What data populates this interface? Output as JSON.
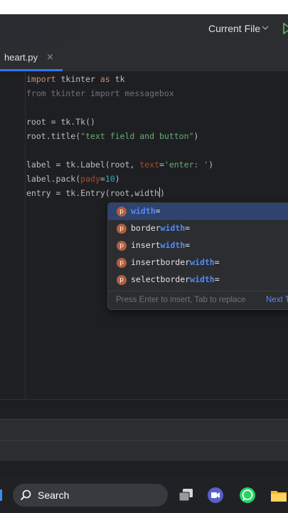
{
  "toolbar": {
    "current_file_label": "Current File",
    "icons": [
      "chevron-down-icon",
      "run-icon"
    ]
  },
  "tabs": [
    {
      "label": "heart.py",
      "close": "×",
      "active": true
    }
  ],
  "editor": {
    "lines": {
      "l1": {
        "a": "import",
        "b": " tkinter ",
        "c": "as",
        "d": " tk"
      },
      "l2": {
        "text": "from tkinter import messagebox"
      },
      "l4": {
        "text": "root = tk.Tk()"
      },
      "l5": {
        "a": "root.title(",
        "b": "\"text field and button\"",
        "c": ")"
      },
      "l7": {
        "a": "label = tk.Label(root, ",
        "b": "text",
        "c": "=",
        "d": "'enter: '",
        "e": ")"
      },
      "l8": {
        "a": "label.pack(",
        "b": "pady",
        "c": "=",
        "d": "10",
        "e": ")"
      },
      "l9": {
        "a": "entry = tk.Entry(root,width",
        "b": ")"
      }
    }
  },
  "completion": {
    "items": [
      {
        "icon": "p",
        "pre": "",
        "match": "width",
        "post": "="
      },
      {
        "icon": "p",
        "pre": "border",
        "match": "width",
        "post": "="
      },
      {
        "icon": "p",
        "pre": "insert",
        "match": "width",
        "post": "="
      },
      {
        "icon": "p",
        "pre": "insertborder",
        "match": "width",
        "post": "="
      },
      {
        "icon": "p",
        "pre": "selectborder",
        "match": "width",
        "post": "="
      }
    ],
    "hint": "Press Enter to insert, Tab to replace",
    "next": "Next Tip"
  },
  "taskbar": {
    "search_label": "Search",
    "icons": [
      "search-icon",
      "task-view-icon",
      "teams-icon",
      "whatsapp-icon",
      "file-explorer-icon"
    ]
  },
  "colors": {
    "accent": "#3574f0",
    "keyword": "#cf8e6d",
    "string": "#6aab73",
    "number": "#2aacb8",
    "param": "#aa4926"
  }
}
